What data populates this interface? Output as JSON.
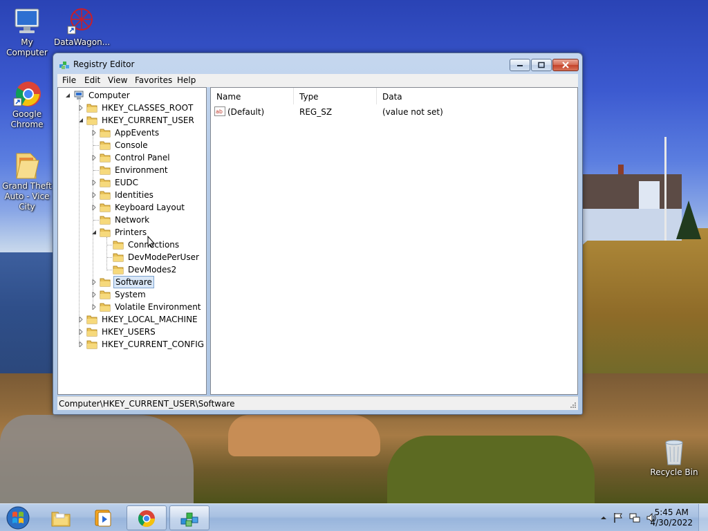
{
  "desktop": {
    "icons": [
      {
        "label": "My Computer"
      },
      {
        "label": "DataWagon..."
      },
      {
        "label": "Google Chrome"
      },
      {
        "label": "Grand Theft Auto - Vice City"
      },
      {
        "label": "Recycle Bin"
      }
    ]
  },
  "window": {
    "title": "Registry Editor",
    "menu": [
      "File",
      "Edit",
      "View",
      "Favorites",
      "Help"
    ],
    "tree": [
      {
        "label": "Computer"
      },
      {
        "label": "HKEY_CLASSES_ROOT"
      },
      {
        "label": "HKEY_CURRENT_USER"
      },
      {
        "label": "AppEvents"
      },
      {
        "label": "Console"
      },
      {
        "label": "Control Panel"
      },
      {
        "label": "Environment"
      },
      {
        "label": "EUDC"
      },
      {
        "label": "Identities"
      },
      {
        "label": "Keyboard Layout"
      },
      {
        "label": "Network"
      },
      {
        "label": "Printers"
      },
      {
        "label": "Connections"
      },
      {
        "label": "DevModePerUser"
      },
      {
        "label": "DevModes2"
      },
      {
        "label": "Software"
      },
      {
        "label": "System"
      },
      {
        "label": "Volatile Environment"
      },
      {
        "label": "HKEY_LOCAL_MACHINE"
      },
      {
        "label": "HKEY_USERS"
      },
      {
        "label": "HKEY_CURRENT_CONFIG"
      }
    ],
    "list": {
      "columns": [
        "Name",
        "Type",
        "Data"
      ],
      "rows": [
        {
          "icon": "string-value-icon",
          "name": "(Default)",
          "type": "REG_SZ",
          "data": "(value not set)"
        }
      ]
    },
    "status": "Computer\\HKEY_CURRENT_USER\\Software"
  },
  "taskbar": {
    "time": "5:45 AM",
    "date": "4/30/2022"
  }
}
